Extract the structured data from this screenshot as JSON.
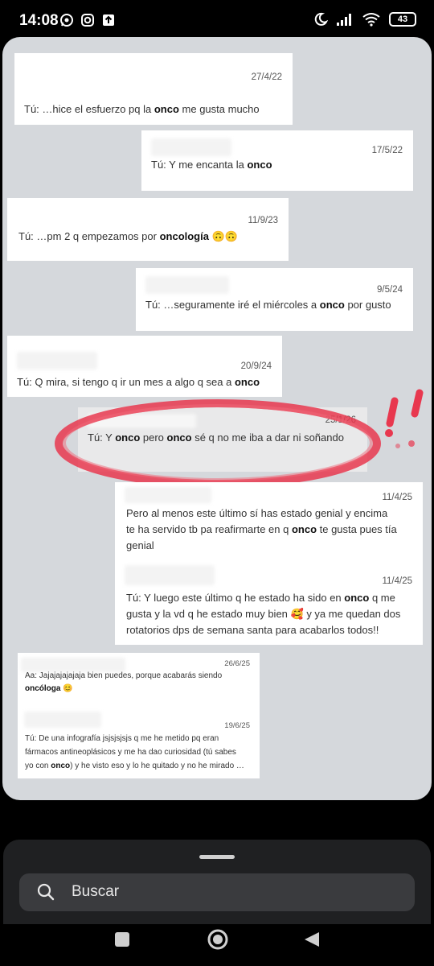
{
  "status_bar": {
    "time": "14:08",
    "battery": "43"
  },
  "messages": [
    {
      "date": "27/4/22",
      "prefix": "Tú:  …hice el esfuerzo pq la ",
      "bold": "onco",
      "suffix": " me gusta mucho"
    },
    {
      "date": "17/5/22",
      "prefix": "Tú: Y me encanta la ",
      "bold": "onco",
      "suffix": ""
    },
    {
      "date": "11/9/23",
      "prefix": "Tú:  …pm 2 q empezamos por ",
      "bold": "oncología",
      "suffix": " 🙃🙃"
    },
    {
      "date": "9/5/24",
      "prefix": "Tú:  …seguramente iré el miércoles a ",
      "bold": "onco",
      "suffix": " por gusto"
    },
    {
      "date": "20/9/24",
      "prefix": "Tú: Q mira, si tengo q ir un mes a algo q sea a ",
      "bold": "onco",
      "suffix": ""
    },
    {
      "date": "25/1/26",
      "prefix": "Tú: Y ",
      "bold": "onco",
      "middle": " pero ",
      "bold2": "onco",
      "suffix": " sé q no me iba a dar ni soñando"
    },
    {
      "date": "11/4/25",
      "line1": "Pero al menos este último sí has estado genial y encima",
      "line2_prefix": "te ha servido tb pa reafirmarte en q ",
      "line2_bold": "onco",
      "line2_suffix": " te gusta pues tía",
      "line3": "genial"
    },
    {
      "date": "11/4/25",
      "line1_prefix": "Tú: Y luego este último q he estado ha sido en ",
      "line1_bold": "onco",
      "line1_suffix": " q me",
      "line2": "gusta y la vd q he estado muy bien 🥰 y ya me quedan dos",
      "line3": "rotatorios dps de semana santa para acabarlos todos!!"
    },
    {
      "date": "26/6/25",
      "line1": "Aa: Jajajajajajaja bien puedes, porque acabarás siendo",
      "line2_bold": "oncóloga",
      "line2_suffix": " 😊"
    },
    {
      "date": "19/6/25",
      "line1": "Tú: De una infografía jsjsjsjsjs q me he metido pq eran",
      "line2": "fármacos antineoplásicos y me ha dao curiosidad (tú sabes",
      "line3_prefix": "yo con ",
      "line3_bold": "onco",
      "line3_suffix": ") y he visto eso y lo he quitado y no he mirado …"
    }
  ],
  "search": {
    "label": "Buscar"
  },
  "colors": {
    "highlight": "#e8384f",
    "viewer_bg": "#d5d8dc"
  }
}
